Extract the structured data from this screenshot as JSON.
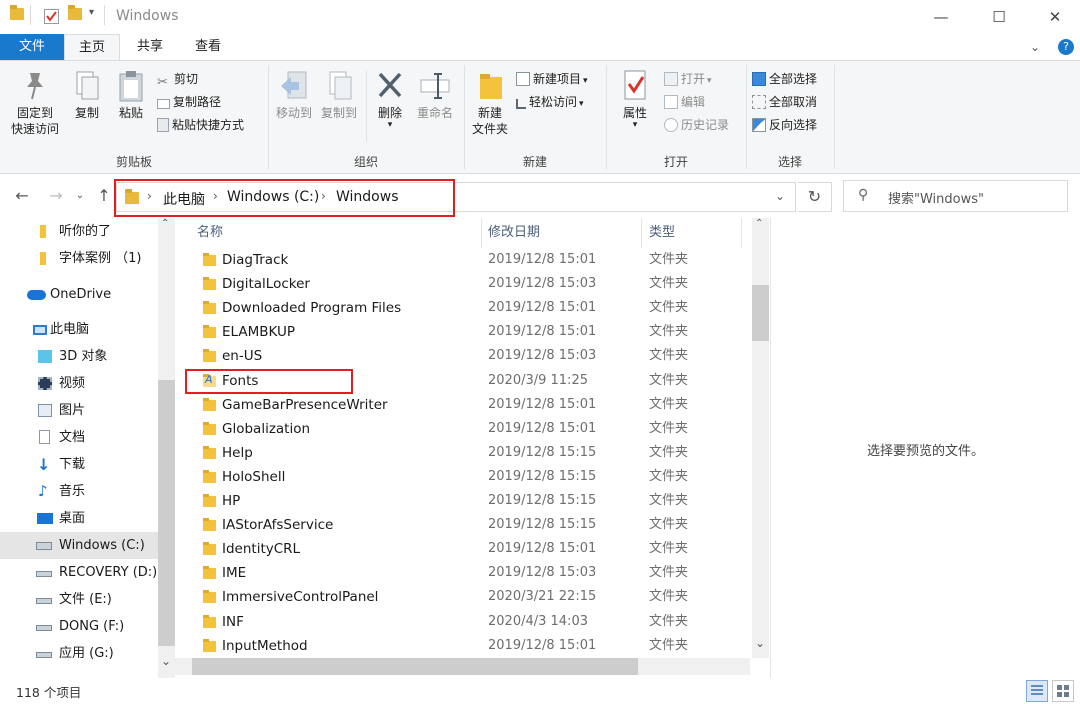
{
  "window": {
    "title": "Windows",
    "controls": {
      "minimize": "—",
      "maximize": "☐",
      "close": "✕"
    }
  },
  "ribbon_tabs": [
    "文件",
    "主页",
    "共享",
    "查看"
  ],
  "ribbon": {
    "clipboard": {
      "group": "剪贴板",
      "pin": "固定到\n快速访问",
      "copy": "复制",
      "paste": "粘贴",
      "cut": "剪切",
      "copy_path": "复制路径",
      "paste_shortcut": "粘贴快捷方式"
    },
    "organize": {
      "group": "组织",
      "move_to": "移动到",
      "copy_to": "复制到",
      "delete": "删除",
      "rename": "重命名"
    },
    "new": {
      "group": "新建",
      "new_folder": "新建\n文件夹",
      "new_item": "新建项目",
      "easy_access": "轻松访问"
    },
    "open": {
      "group": "打开",
      "properties": "属性",
      "open": "打开",
      "edit": "编辑",
      "history": "历史记录"
    },
    "select": {
      "group": "选择",
      "select_all": "全部选择",
      "select_none": "全部取消",
      "invert": "反向选择"
    }
  },
  "address": {
    "crumbs": [
      "此电脑",
      "Windows (C:)",
      "Windows"
    ],
    "search_placeholder": "搜索\"Windows\""
  },
  "nav": [
    {
      "label": "听你的了",
      "icon": "folder-icon"
    },
    {
      "label": "字体案例 （1)",
      "icon": "folder-icon"
    },
    {
      "label": "OneDrive",
      "icon": "onedrive-icon"
    },
    {
      "label": "此电脑",
      "icon": "this-pc-icon"
    },
    {
      "label": "3D 对象",
      "icon": "3d-objects-icon"
    },
    {
      "label": "视频",
      "icon": "video-icon"
    },
    {
      "label": "图片",
      "icon": "pictures-icon"
    },
    {
      "label": "文档",
      "icon": "documents-icon"
    },
    {
      "label": "下载",
      "icon": "download-icon"
    },
    {
      "label": "音乐",
      "icon": "music-icon"
    },
    {
      "label": "桌面",
      "icon": "desktop-icon"
    },
    {
      "label": "Windows (C:)",
      "icon": "drive-c-icon"
    },
    {
      "label": "RECOVERY (D:)",
      "icon": "drive-icon"
    },
    {
      "label": "文件 (E:)",
      "icon": "drive-icon"
    },
    {
      "label": "DONG (F:)",
      "icon": "drive-icon"
    },
    {
      "label": "应用 (G:)",
      "icon": "drive-icon"
    }
  ],
  "columns": {
    "name": "名称",
    "date": "修改日期",
    "type": "类型"
  },
  "files": [
    {
      "name": "DiagTrack",
      "date": "2019/12/8 15:01",
      "type": "文件夹"
    },
    {
      "name": "DigitalLocker",
      "date": "2019/12/8 15:03",
      "type": "文件夹"
    },
    {
      "name": "Downloaded Program Files",
      "date": "2019/12/8 15:01",
      "type": "文件夹"
    },
    {
      "name": "ELAMBKUP",
      "date": "2019/12/8 15:01",
      "type": "文件夹"
    },
    {
      "name": "en-US",
      "date": "2019/12/8 15:03",
      "type": "文件夹"
    },
    {
      "name": "Fonts",
      "date": "2020/3/9 11:25",
      "type": "文件夹"
    },
    {
      "name": "GameBarPresenceWriter",
      "date": "2019/12/8 15:01",
      "type": "文件夹"
    },
    {
      "name": "Globalization",
      "date": "2019/12/8 15:01",
      "type": "文件夹"
    },
    {
      "name": "Help",
      "date": "2019/12/8 15:15",
      "type": "文件夹"
    },
    {
      "name": "HoloShell",
      "date": "2019/12/8 15:15",
      "type": "文件夹"
    },
    {
      "name": "HP",
      "date": "2019/12/8 15:15",
      "type": "文件夹"
    },
    {
      "name": "IAStorAfsService",
      "date": "2019/12/8 15:15",
      "type": "文件夹"
    },
    {
      "name": "IdentityCRL",
      "date": "2019/12/8 15:01",
      "type": "文件夹"
    },
    {
      "name": "IME",
      "date": "2019/12/8 15:03",
      "type": "文件夹"
    },
    {
      "name": "ImmersiveControlPanel",
      "date": "2020/3/21 22:15",
      "type": "文件夹"
    },
    {
      "name": "INF",
      "date": "2020/4/3 14:03",
      "type": "文件夹"
    },
    {
      "name": "InputMethod",
      "date": "2019/12/8 15:01",
      "type": "文件夹"
    }
  ],
  "preview_text": "选择要预览的文件。",
  "status": {
    "count": "118 个项目"
  },
  "colors": {
    "accent": "#1979ca",
    "highlight": "#e02020",
    "folder": "#f5c23e"
  }
}
